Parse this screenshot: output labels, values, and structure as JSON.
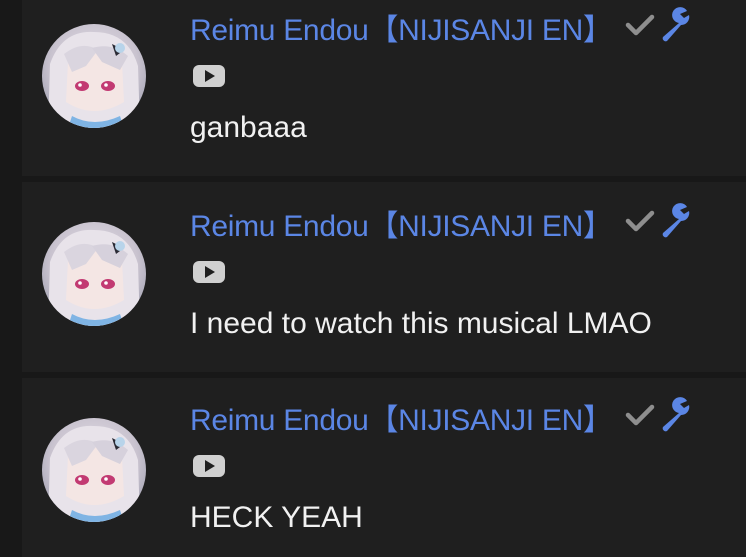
{
  "colors": {
    "background": "#181818",
    "message_background": "#1f1f1f",
    "author_name": "#5b86e5",
    "message_text": "#f1f1f1",
    "icon_gray": "#8e8e8e",
    "wrench_blue": "#5b86e5"
  },
  "messages": [
    {
      "author": "Reimu Endou【NIJISANJI EN】",
      "badges": [
        "check-icon",
        "wrench-icon"
      ],
      "platform_icon": "youtube-icon",
      "text": "ganbaaa"
    },
    {
      "author": "Reimu Endou【NIJISANJI EN】",
      "badges": [
        "check-icon",
        "wrench-icon"
      ],
      "platform_icon": "youtube-icon",
      "text": "I need to watch this musical LMAO"
    },
    {
      "author": "Reimu Endou【NIJISANJI EN】",
      "badges": [
        "check-icon",
        "wrench-icon"
      ],
      "platform_icon": "youtube-icon",
      "text": "HECK YEAH"
    }
  ]
}
